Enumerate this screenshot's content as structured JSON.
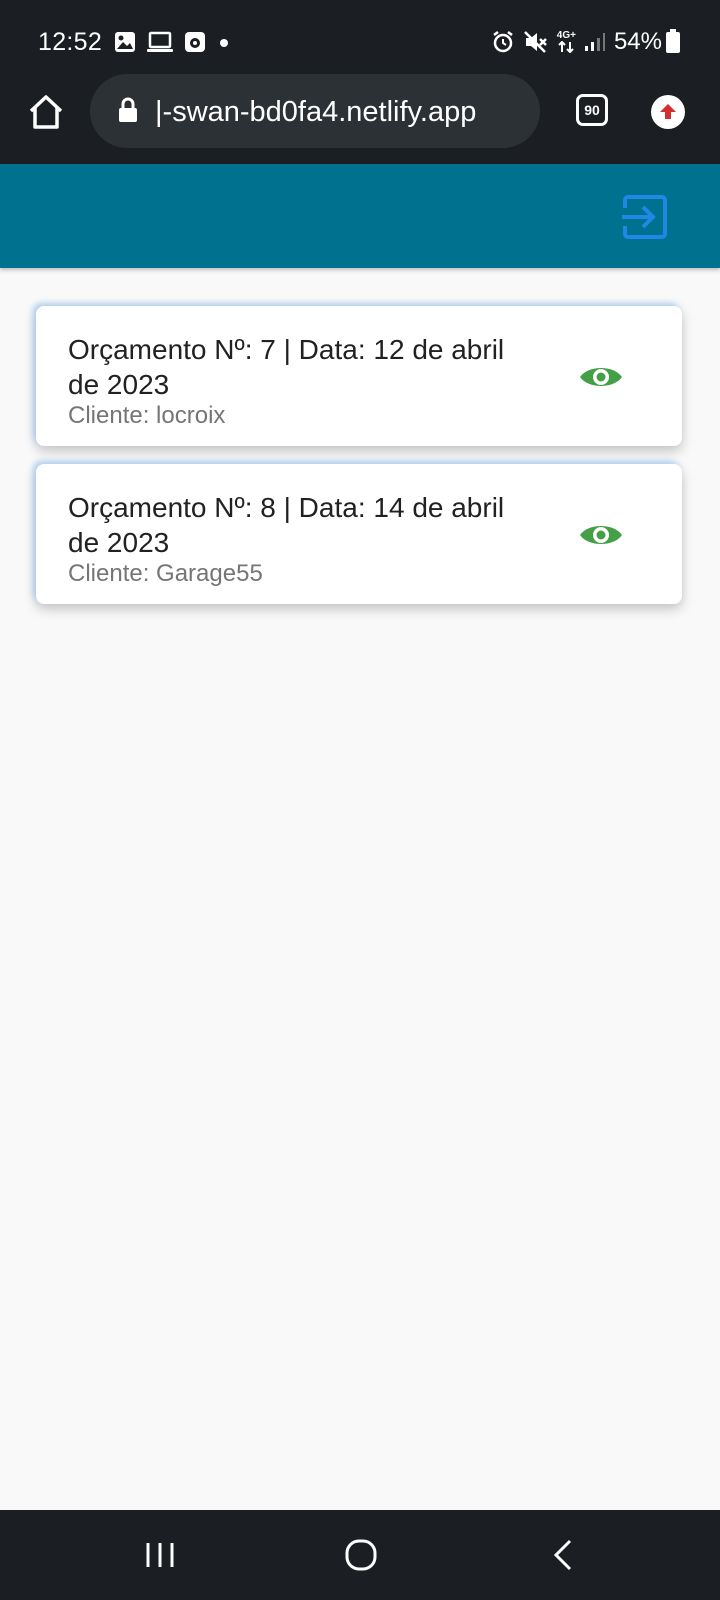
{
  "status_bar": {
    "time": "12:52",
    "network_label": "4G+",
    "battery": "54%",
    "icons": [
      "gallery-icon",
      "laptop-icon",
      "screen-recorder-icon",
      "dot-icon",
      "alarm-icon",
      "mute-icon",
      "network-4g-icon",
      "signal-icon",
      "battery-icon"
    ]
  },
  "browser": {
    "url": "|-swan-bd0fa4.netlify.app",
    "tab_count": "90",
    "icons": [
      "home-icon",
      "lock-icon",
      "tabs-icon",
      "update-arrow-icon"
    ]
  },
  "header": {
    "background_color": "#00718e",
    "logout_icon": "logout-icon",
    "icon_color": "#1e88e5"
  },
  "budgets": [
    {
      "title": "Orçamento Nº: 7 | Data: 12 de abril de 2023",
      "client": "Cliente: locroix",
      "action_icon": "eye-icon"
    },
    {
      "title": "Orçamento Nº: 8 | Data: 14 de abril de 2023",
      "client": "Cliente: Garage55",
      "action_icon": "eye-icon"
    }
  ],
  "colors": {
    "eye_icon": "#43a047",
    "page_background": "#f9f9f9",
    "system_bars": "#1b1e22"
  },
  "nav_bar": {
    "icons": [
      "recent-apps-icon",
      "home-circle-icon",
      "back-icon"
    ]
  }
}
